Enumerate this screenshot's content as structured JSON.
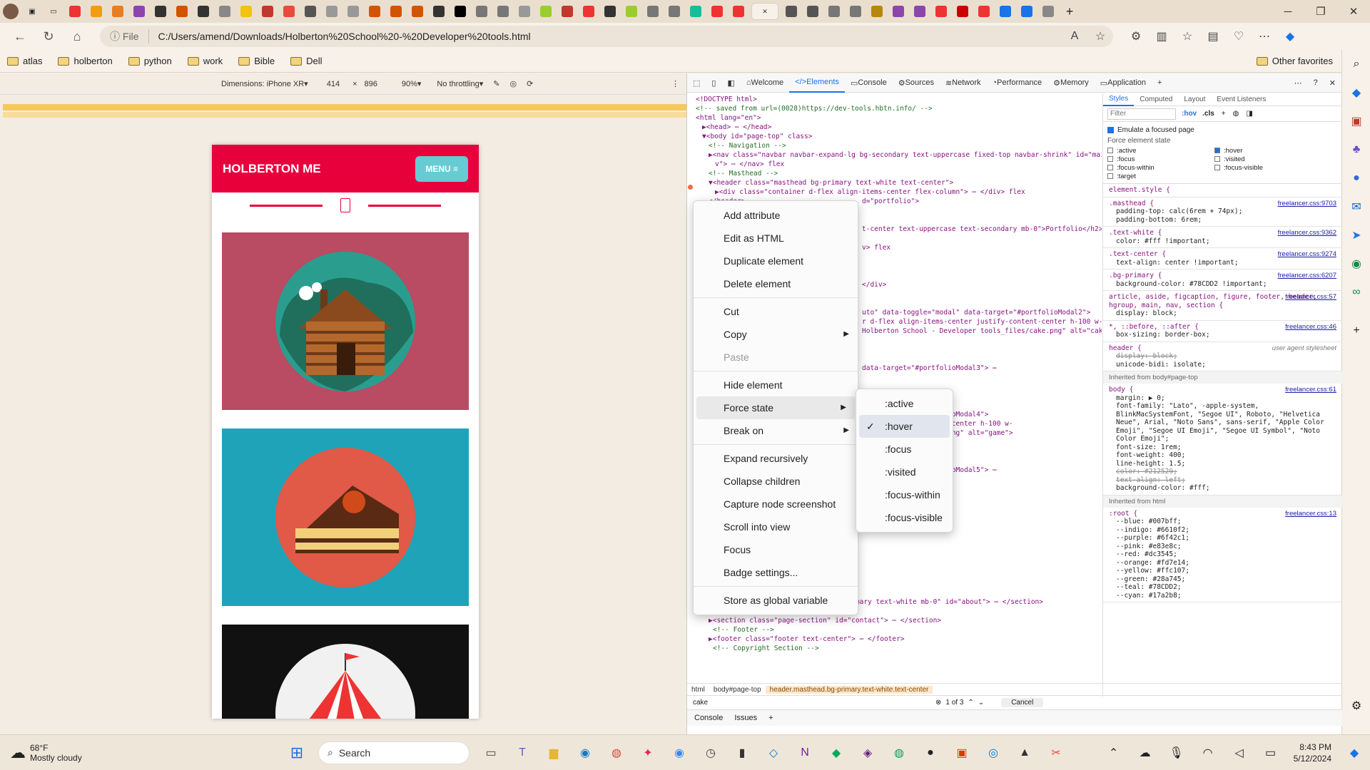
{
  "window": {
    "minimize": "─",
    "maximize": "❐",
    "close": "✕"
  },
  "tabs": {
    "count_visible": 46,
    "new_tab": "+"
  },
  "address": {
    "scheme_label": "File",
    "url": "C:/Users/amend/Downloads/Holberton%20School%20-%20Developer%20tools.html"
  },
  "bookmarks": [
    {
      "label": "atlas"
    },
    {
      "label": "holberton"
    },
    {
      "label": "python"
    },
    {
      "label": "work"
    },
    {
      "label": "Bible"
    },
    {
      "label": "Dell"
    }
  ],
  "other_favorites": "Other favorites",
  "device_toolbar": {
    "dimensions_label": "Dimensions: iPhone XR",
    "width": "414",
    "x": "×",
    "height": "896",
    "zoom": "90%",
    "throttle": "No throttling"
  },
  "page": {
    "brand": "HOLBERTON ME",
    "menu": "MENU ≡",
    "scroll_top_glyph": "⌃"
  },
  "devtools": {
    "tabs": [
      {
        "label": "Welcome"
      },
      {
        "label": "Elements"
      },
      {
        "label": "Console"
      },
      {
        "label": "Sources"
      },
      {
        "label": "Network"
      },
      {
        "label": "Performance"
      },
      {
        "label": "Memory"
      },
      {
        "label": "Application"
      }
    ],
    "add_tab": "+",
    "styles_tabs": [
      "Styles",
      "Computed",
      "Layout",
      "Event Listeners"
    ],
    "filter_placeholder": "Filter",
    "hov": ":hov",
    "cls": ".cls",
    "emulate_focus": "Emulate a focused page",
    "force_state_title": "Force element state",
    "states_left": [
      ":active",
      ":focus",
      ":focus-within",
      ":target"
    ],
    "states_right": [
      ":hover",
      ":visited",
      ":focus-visible"
    ],
    "breadcrumbs": [
      "html",
      "body#page-top",
      "header.masthead.bg-primary.text-white.text-center"
    ],
    "search_value": "cake",
    "search_count": "1 of 3",
    "cancel": "Cancel",
    "drawer_tabs": [
      "Console",
      "Issues"
    ]
  },
  "code_lines": [
    "<!DOCTYPE html>",
    "<!-- saved from url=(0028)https://dev-tools.hbtn.info/ -->",
    "<html lang=\"en\">",
    "▶<head> ⋯ </head>",
    "▼<body id=\"page-top\" class>",
    "<!-- Navigation -->",
    "▶<nav class=\"navbar navbar-expand-lg bg-secondary text-uppercase fixed-top navbar-shrink\" id=\"mainNa",
    "v\"> ⋯ </nav> flex",
    "<!-- Masthead -->",
    "▼<header class=\"masthead bg-primary text-white text-center\">",
    "▶<div class=\"container d-flex align-items-center flex-column\"> ⋯ </div> flex",
    "</header>"
  ],
  "code_right_fragments": [
    {
      "row": 11,
      "text": "d=\"portfolio\">"
    },
    {
      "row": 14,
      "text": "t-center text-uppercase text-secondary mb-0\">Portfolio</h2>"
    },
    {
      "row": 16,
      "text": "v> flex"
    },
    {
      "row": 20,
      "text": "</div>"
    },
    {
      "row": 23,
      "text": "uto\" data-toggle=\"modal\" data-target=\"#portfolioModal2\">"
    },
    {
      "row": 24,
      "text": "r d-flex align-items-center justify-content-center h-100 w-"
    },
    {
      "row": 25,
      "text": "Holberton School - Developer tools_files/cake.png\" alt=\"cake\">"
    },
    {
      "row": 29,
      "text": "data-target=\"#portfolioModal3\"> ⋯"
    },
    {
      "row": 34,
      "text": "data-target=\"#portfolioModal4\">"
    },
    {
      "row": 35,
      "text": "enter justify-content-center h-100 w-"
    },
    {
      "row": 36,
      "text": "per tools_files/game.png\" alt=\"game\">"
    },
    {
      "row": 40,
      "text": "data-target=\"#portfolioModal5\"> ⋯"
    },
    {
      "row": 44,
      "text": "</div>"
    }
  ],
  "code_bottom_lines": [
    "<!-- About Section -->",
    "▶<section class=\"page-section bg-primary text-white mb-0\" id=\"about\"> ⋯ </section>",
    "<!-- Contact Section -->",
    "▶<section class=\"page-section\" id=\"contact\"> ⋯ </section>",
    "<!-- Footer -->",
    "▶<footer class=\"footer text-center\"> ⋯ </footer>",
    "<!-- Copyright Section -->"
  ],
  "style_rules": [
    {
      "sel": "element.style {",
      "src": "",
      "props": []
    },
    {
      "sel": ".masthead {",
      "src": "freelancer.css:9703",
      "props": [
        "padding-top: calc(6rem + 74px);",
        "padding-bottom: 6rem;"
      ]
    },
    {
      "sel": ".text-white {",
      "src": "freelancer.css:9362",
      "props": [
        "color: #fff !important;"
      ]
    },
    {
      "sel": ".text-center {",
      "src": "freelancer.css:9274",
      "props": [
        "text-align: center !important;"
      ]
    },
    {
      "sel": ".bg-primary {",
      "src": "freelancer.css:6207",
      "props": [
        "background-color: #78CDD2 !important;"
      ]
    },
    {
      "sel": "article, aside, figcaption, figure, footer, header, hgroup, main, nav, section {",
      "src": "freelancer.css:57",
      "props": [
        "display: block;"
      ]
    },
    {
      "sel": "*, ::before, ::after {",
      "src": "freelancer.css:46",
      "props": [
        "box-sizing: border-box;"
      ]
    },
    {
      "sel": "header {",
      "src": "user agent stylesheet",
      "props": [
        "display: block;",
        "unicode-bidi: isolate;"
      ]
    }
  ],
  "inherited_body": "Inherited from body#page-top",
  "body_rule": {
    "sel": "body {",
    "src": "freelancer.css:61",
    "props": [
      "margin: ▶ 0;",
      "font-family: \"Lato\", -apple-system, BlinkMacSystemFont, \"Segoe UI\", Roboto, \"Helvetica Neue\", Arial, \"Noto Sans\", sans-serif, \"Apple Color Emoji\", \"Segoe UI Emoji\", \"Segoe UI Symbol\", \"Noto Color Emoji\";",
      "font-size: 1rem;",
      "font-weight: 400;",
      "line-height: 1.5;",
      "color: #212529;",
      "text-align: left;",
      "background-color: #fff;"
    ]
  },
  "inherited_html": "Inherited from html",
  "root_rule": {
    "sel": ":root {",
    "src": "freelancer.css:13",
    "props": [
      "--blue: #007bff;",
      "--indigo: #6610f2;",
      "--purple: #6f42c1;",
      "--pink: #e83e8c;",
      "--red: #dc3545;",
      "--orange: #fd7e14;",
      "--yellow: #ffc107;",
      "--green: #28a745;",
      "--teal: #78CDD2;",
      "--cyan: #17a2b8;"
    ]
  },
  "context_menu": [
    {
      "label": "Add attribute"
    },
    {
      "label": "Edit as HTML"
    },
    {
      "label": "Duplicate element"
    },
    {
      "label": "Delete element"
    },
    {
      "sep": true
    },
    {
      "label": "Cut"
    },
    {
      "label": "Copy",
      "sub": true
    },
    {
      "label": "Paste",
      "disabled": true
    },
    {
      "sep": true
    },
    {
      "label": "Hide element"
    },
    {
      "label": "Force state",
      "sub": true,
      "hl": true
    },
    {
      "label": "Break on",
      "sub": true
    },
    {
      "sep": true
    },
    {
      "label": "Expand recursively"
    },
    {
      "label": "Collapse children"
    },
    {
      "label": "Capture node screenshot"
    },
    {
      "label": "Scroll into view"
    },
    {
      "label": "Focus"
    },
    {
      "label": "Badge settings..."
    },
    {
      "sep": true
    },
    {
      "label": "Store as global variable"
    }
  ],
  "submenu": [
    {
      "label": ":active"
    },
    {
      "label": ":hover",
      "checked": true
    },
    {
      "label": ":focus"
    },
    {
      "label": ":visited"
    },
    {
      "label": ":focus-within"
    },
    {
      "label": ":focus-visible"
    }
  ],
  "taskbar": {
    "weather_temp": "68°F",
    "weather_desc": "Mostly cloudy",
    "search_placeholder": "Search",
    "time": "8:43 PM",
    "date": "5/12/2024"
  },
  "colors": {
    "brand_red": "#e8003d",
    "teal_card": "#1fa3b8",
    "pink_card": "#b94b62",
    "accent": "#1a73e8"
  }
}
